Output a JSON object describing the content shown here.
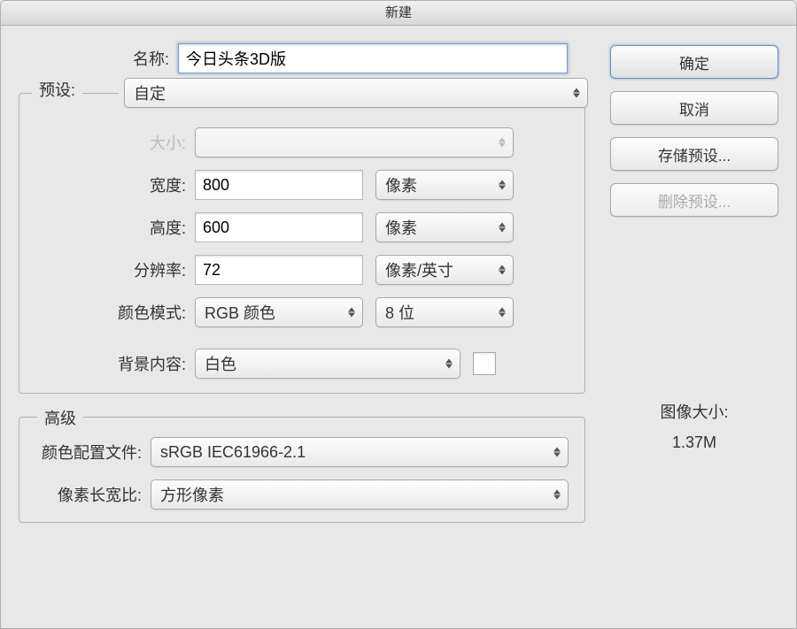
{
  "window": {
    "title": "新建"
  },
  "buttons": {
    "ok": "确定",
    "cancel": "取消",
    "save_preset": "存储预设...",
    "delete_preset": "删除预设..."
  },
  "labels": {
    "name": "名称:",
    "preset": "预设:",
    "size": "大小:",
    "width": "宽度:",
    "height": "高度:",
    "resolution": "分辨率:",
    "color_mode": "颜色模式:",
    "background": "背景内容:",
    "advanced": "高级",
    "color_profile": "颜色配置文件:",
    "pixel_aspect": "像素长宽比:",
    "image_size_label": "图像大小:"
  },
  "values": {
    "name": "今日头条3D版",
    "preset": "自定",
    "size": "",
    "width": "800",
    "width_unit": "像素",
    "height": "600",
    "height_unit": "像素",
    "resolution": "72",
    "resolution_unit": "像素/英寸",
    "color_mode": "RGB 颜色",
    "bit_depth": "8 位",
    "background": "白色",
    "color_profile": "sRGB IEC61966-2.1",
    "pixel_aspect": "方形像素",
    "image_size": "1.37M"
  }
}
